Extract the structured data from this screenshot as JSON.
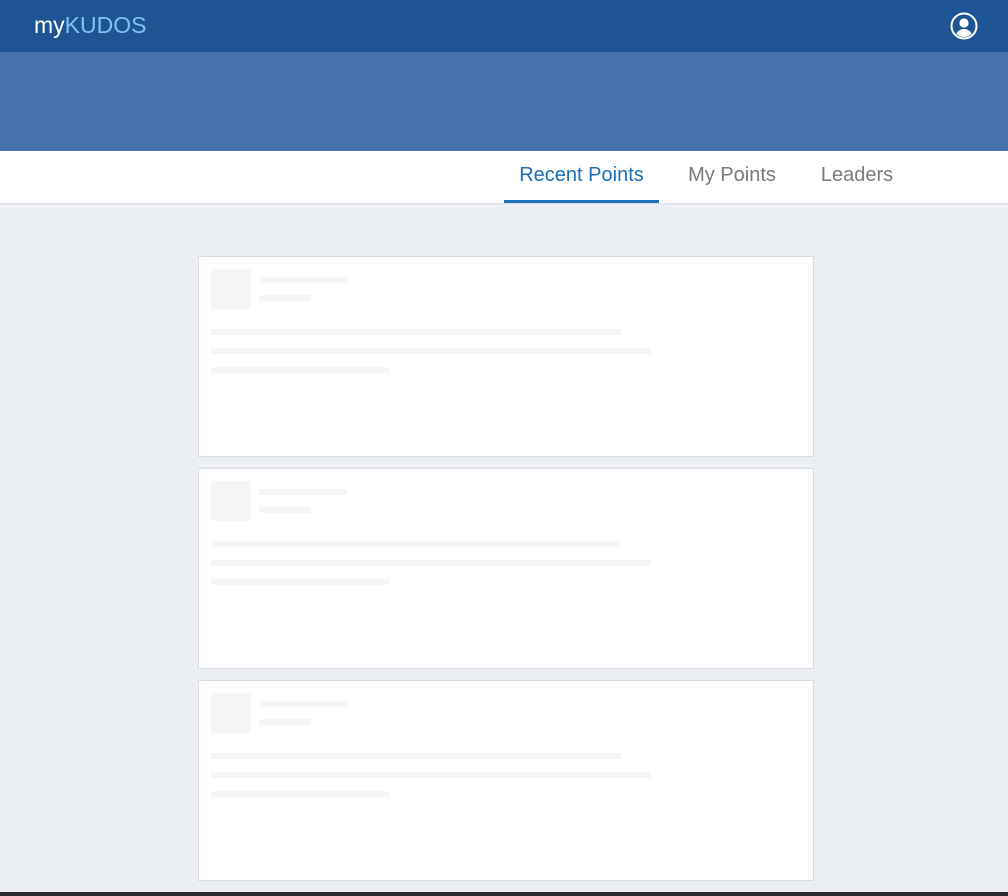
{
  "header": {
    "brand_prefix": "my",
    "brand_suffix": "KUDOS",
    "user_icon": "user-account-icon"
  },
  "tabs": [
    {
      "label": "Recent Points",
      "active": true
    },
    {
      "label": "My Points",
      "active": false
    },
    {
      "label": "Leaders",
      "active": false
    }
  ],
  "feed": {
    "state": "loading",
    "placeholder_cards": 3
  },
  "colors": {
    "topbar": "#1f5494",
    "hero": "#4673ab",
    "brand_accent": "#7ec3f2",
    "active_tab": "#1a6fb6",
    "page_background": "#ebeff3"
  }
}
